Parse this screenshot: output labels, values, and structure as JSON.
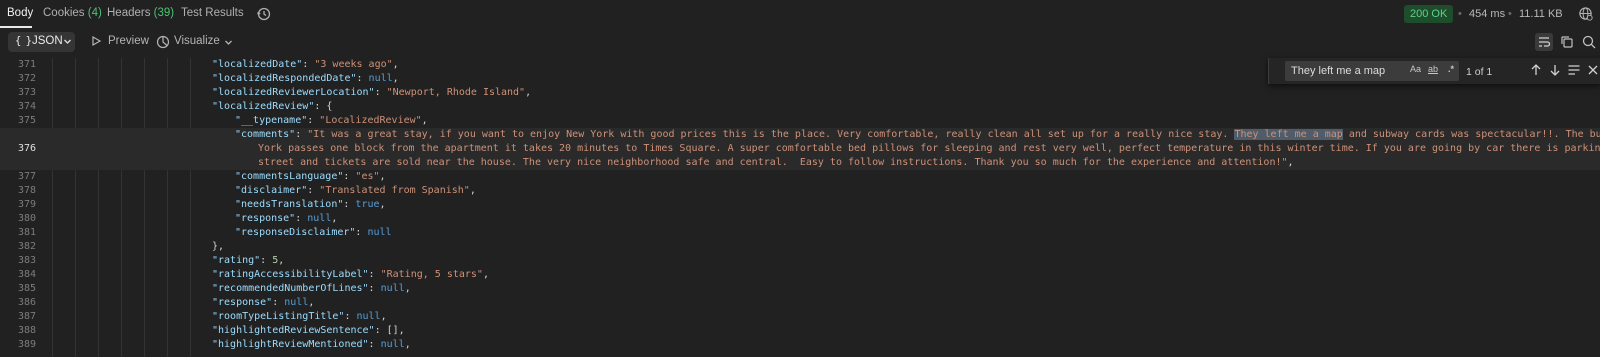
{
  "tabs": {
    "body": "Body",
    "cookies": "Cookies",
    "cookies_count": "(4)",
    "headers": "Headers",
    "headers_count": "(39)",
    "tests": "Test Results"
  },
  "status": {
    "code": "200 OK",
    "time": "454 ms",
    "size": "11.11 KB",
    "code_color": "#5bd28a"
  },
  "toolbar": {
    "format": "JSON",
    "preview": "Preview",
    "visualize": "Visualize"
  },
  "find": {
    "query": "They left me a map",
    "match_case": "Aa",
    "whole_word": "ab",
    "regex": ".*",
    "count": "1 of 1"
  },
  "code": {
    "l371": "371",
    "l372": "372",
    "l373": "373",
    "l374": "374",
    "l375": "375",
    "l376": "376",
    "l377": "377",
    "l378": "378",
    "l379": "379",
    "l380": "380",
    "l381": "381",
    "l382": "382",
    "l383": "383",
    "l384": "384",
    "l385": "385",
    "l386": "386",
    "l387": "387",
    "l388": "388",
    "l389": "389",
    "k_localizedDate": "\"localizedDate\"",
    "v_localizedDate": "\"3 weeks ago\"",
    "k_localizedRespondedDate": "\"localizedRespondedDate\"",
    "k_localizedReviewerLocation": "\"localizedReviewerLocation\"",
    "v_localizedReviewerLocation": "\"Newport, Rhode Island\"",
    "k_localizedReview": "\"localizedReview\"",
    "k_typename": "\"__typename\"",
    "v_typename": "\"LocalizedReview\"",
    "k_comments": "\"comments\"",
    "v_comments_1a": "\"It was a great stay, if you want to enjoy New York with good prices this is the place. Very comfortable, really clean all set up for a really nice stay. ",
    "v_comments_match": "They left me a map",
    "v_comments_1b": " and subway cards was spectacular!!. The bus to new",
    "v_comments_2": "York passes one block from the apartment it takes 20 minutes to Times Square. A super comfortable bed pillows for sleeping and rest very well, perfect temperature in this winter time. If you are going by car there is parking on the",
    "v_comments_3": "street and tickets are sold near the house. The very nice neighborhood safe and central.  Easy to follow instructions. Thank you so much for the experience and attention!\"",
    "k_commentsLanguage": "\"commentsLanguage\"",
    "v_commentsLanguage": "\"es\"",
    "k_disclaimer": "\"disclaimer\"",
    "v_disclaimer": "\"Translated from Spanish\"",
    "k_needsTranslation": "\"needsTranslation\"",
    "v_true": "true",
    "k_response": "\"response\"",
    "k_responseDisclaimer": "\"responseDisclaimer\"",
    "v_null": "null",
    "close_obj": "},",
    "k_rating": "\"rating\"",
    "v_rating": "5",
    "k_ratingAccessibilityLabel": "\"ratingAccessibilityLabel\"",
    "v_ratingAccessibilityLabel": "\"Rating, 5 stars\"",
    "k_recommendedNumberOfLines": "\"recommendedNumberOfLines\"",
    "k_roomTypeListingTitle": "\"roomTypeListingTitle\"",
    "k_highlightedReviewSentence": "\"highlightedReviewSentence\"",
    "v_empty_array": "[]",
    "k_highlightReviewMentioned": "\"highlightReviewMentioned\""
  }
}
